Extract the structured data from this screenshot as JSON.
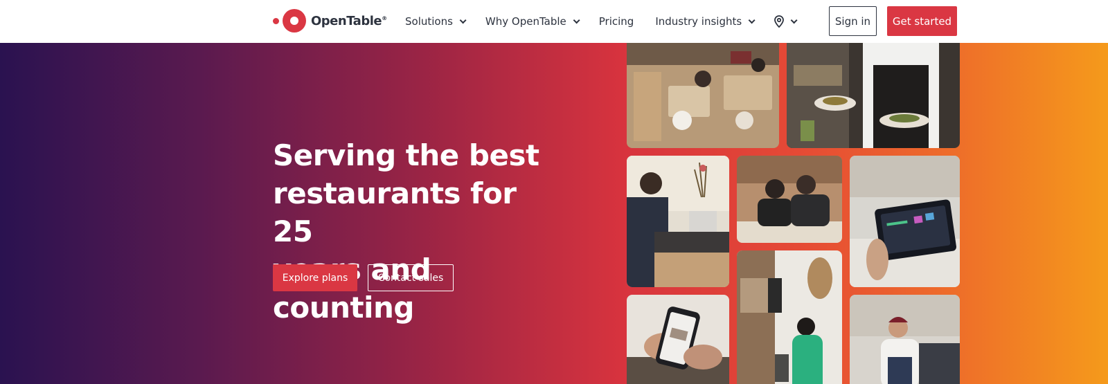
{
  "header": {
    "logo_text": "OpenTable",
    "logo_reg": "®",
    "nav": [
      {
        "label": "Solutions",
        "has_dropdown": true
      },
      {
        "label": "Why OpenTable",
        "has_dropdown": true
      },
      {
        "label": "Pricing",
        "has_dropdown": false
      },
      {
        "label": "Industry insights",
        "has_dropdown": true
      }
    ],
    "location_icon": "location-pin-icon",
    "signin_label": "Sign in",
    "get_started_label": "Get started"
  },
  "hero": {
    "headline_lines": [
      "Serving the best",
      "restaurants for 25",
      "years and counting"
    ],
    "explore_label": "Explore plans",
    "contact_label": "Contact sales",
    "photos": [
      "restaurant-dining-room-photo",
      "chef-serving-plates-photo",
      "host-at-stand-photo",
      "staff-smiling-photo",
      "tablet-pos-photo",
      "host-greeting-photo",
      "phone-app-photo",
      "chef-portrait-photo"
    ]
  },
  "colors": {
    "brand_red": "#da3743",
    "text_dark": "#2d333f",
    "gradient_start": "#2a1250",
    "gradient_end": "#f59a1b"
  }
}
